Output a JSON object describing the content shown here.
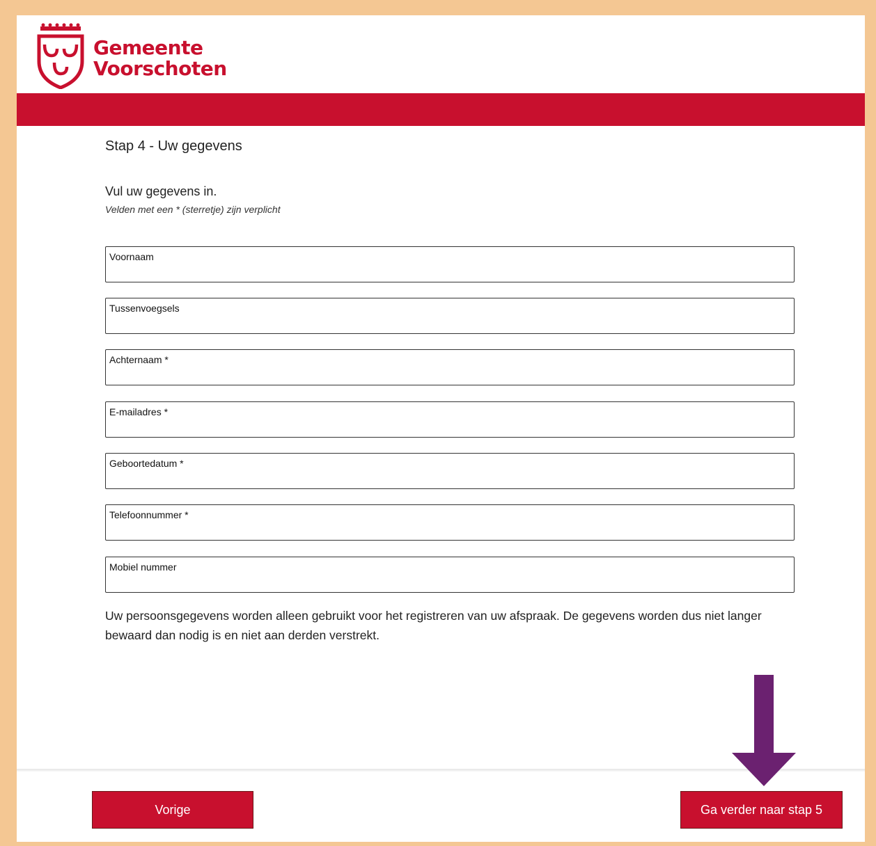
{
  "brand": {
    "line1": "Gemeente",
    "line2": "Voorschoten",
    "color": "#c8102e"
  },
  "step": {
    "title": "Stap 4 - Uw gegevens"
  },
  "form": {
    "intro": "Vul uw gegevens in.",
    "required_note": "Velden met een * (sterretje) zijn verplicht",
    "fields": [
      {
        "label": "Voornaam",
        "value": ""
      },
      {
        "label": "Tussenvoegsels",
        "value": ""
      },
      {
        "label": "Achternaam *",
        "value": ""
      },
      {
        "label": "E-mailadres *",
        "value": ""
      },
      {
        "label": "Geboortedatum *",
        "value": ""
      },
      {
        "label": "Telefoonnummer *",
        "value": ""
      },
      {
        "label": "Mobiel nummer",
        "value": ""
      }
    ],
    "privacy": "Uw persoonsgegevens worden alleen gebruikt voor het registreren van uw afspraak. De gegevens worden dus niet langer bewaard dan nodig is en niet aan derden verstrekt."
  },
  "footer": {
    "prev_label": "Vorige",
    "next_label": "Ga verder naar stap 5"
  },
  "annotation": {
    "arrow_icon": "down-arrow-icon",
    "arrow_color": "#6b2170"
  }
}
